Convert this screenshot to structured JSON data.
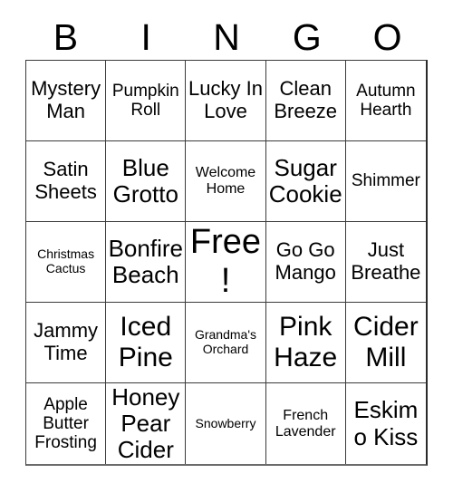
{
  "card": {
    "title": "BINGO",
    "header_letters": [
      "B",
      "I",
      "N",
      "G",
      "O"
    ],
    "colors": {
      "background": "#ffffff",
      "text": "#000000",
      "grid_line": "#3b3b3b"
    },
    "grid": {
      "columns": 5,
      "rows": 5,
      "free_space": "Free!",
      "cells": [
        {
          "text": "Mystery Man",
          "size": "l"
        },
        {
          "text": "Pumpkin Roll",
          "size": "m"
        },
        {
          "text": "Lucky In Love",
          "size": "l"
        },
        {
          "text": "Clean Breeze",
          "size": "l"
        },
        {
          "text": "Autumn Hearth",
          "size": "m"
        },
        {
          "text": "Satin Sheets",
          "size": "l"
        },
        {
          "text": "Blue Grotto",
          "size": "xl"
        },
        {
          "text": "Welcome Home",
          "size": "s"
        },
        {
          "text": "Sugar Cookie",
          "size": "xl"
        },
        {
          "text": "Shimmer",
          "size": "m"
        },
        {
          "text": "Christmas Cactus",
          "size": "xs"
        },
        {
          "text": "Bonfire Beach",
          "size": "xl"
        },
        {
          "text": "Free!",
          "size": "free"
        },
        {
          "text": "Go Go Mango",
          "size": "l"
        },
        {
          "text": "Just Breathe",
          "size": "l"
        },
        {
          "text": "Jammy Time",
          "size": "l"
        },
        {
          "text": "Iced Pine",
          "size": "xxl"
        },
        {
          "text": "Grandma's Orchard",
          "size": "xs"
        },
        {
          "text": "Pink Haze",
          "size": "xxl"
        },
        {
          "text": "Cider Mill",
          "size": "xxl"
        },
        {
          "text": "Apple Butter Frosting",
          "size": "m"
        },
        {
          "text": "Honey Pear Cider",
          "size": "xl"
        },
        {
          "text": "Snowberry",
          "size": "xs"
        },
        {
          "text": "French Lavender",
          "size": "s"
        },
        {
          "text": "Eskimo Kiss",
          "size": "xl"
        }
      ]
    }
  }
}
